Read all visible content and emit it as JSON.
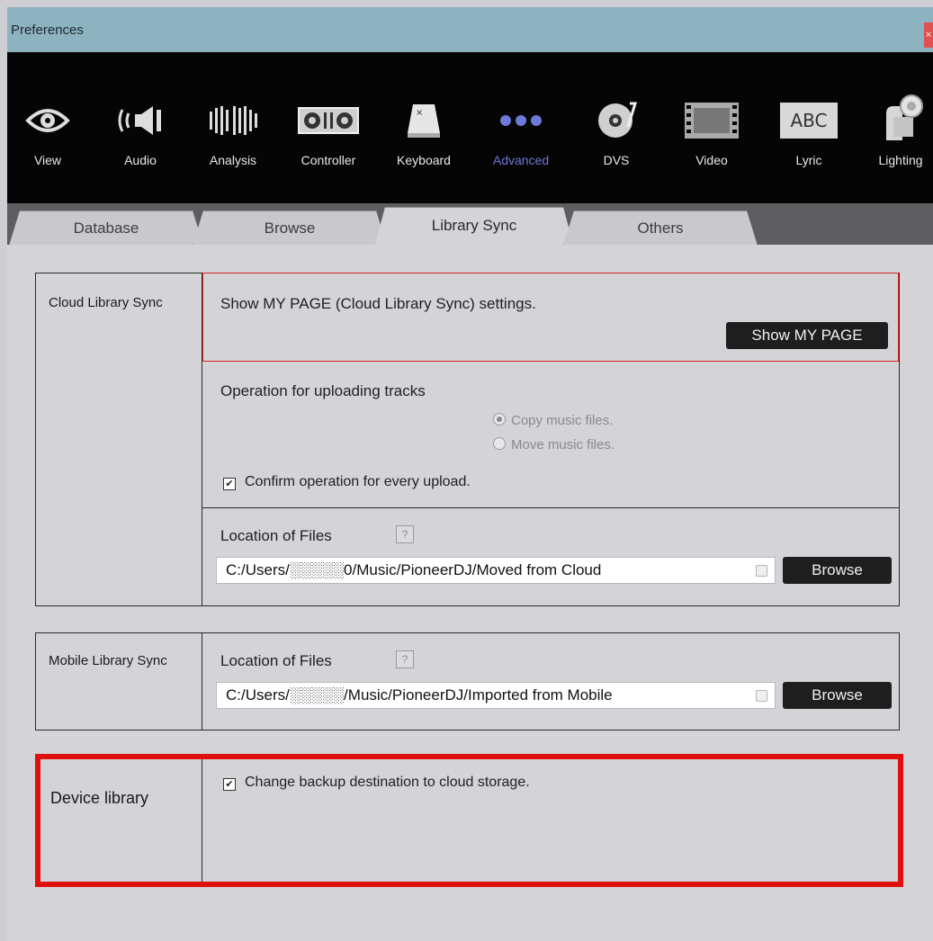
{
  "window": {
    "title": "Preferences",
    "close_label": "×"
  },
  "toolbar": [
    {
      "label": "View",
      "icon": "eye-icon"
    },
    {
      "label": "Audio",
      "icon": "speaker-icon"
    },
    {
      "label": "Analysis",
      "icon": "waveform-bars-icon"
    },
    {
      "label": "Controller",
      "icon": "controller-icon"
    },
    {
      "label": "Keyboard",
      "icon": "keyboard-key-icon"
    },
    {
      "label": "Advanced",
      "icon": "three-dots-icon",
      "active": true
    },
    {
      "label": "DVS",
      "icon": "turntable-icon"
    },
    {
      "label": "Video",
      "icon": "film-strip-icon"
    },
    {
      "label": "Lyric",
      "icon": "abc-icon",
      "icon_text": "ABC"
    },
    {
      "label": "Lighting",
      "icon": "moving-head-light-icon"
    }
  ],
  "tabs": [
    {
      "label": "Database"
    },
    {
      "label": "Browse"
    },
    {
      "label": "Library Sync",
      "active": true
    },
    {
      "label": "Others"
    }
  ],
  "cloud": {
    "category": "Cloud Library Sync",
    "show_text": "Show MY PAGE (Cloud Library Sync) settings.",
    "show_button": "Show MY PAGE",
    "upload_heading": "Operation for uploading tracks",
    "radio_copy": "Copy music files.",
    "radio_move": "Move music files.",
    "confirm_label": "Confirm operation for every upload.",
    "location_label": "Location of Files",
    "help": "?",
    "path": "C:/Users/░░░░░0/Music/PioneerDJ/Moved from Cloud",
    "browse": "Browse"
  },
  "mobile": {
    "category": "Mobile Library Sync",
    "location_label": "Location of Files",
    "help": "?",
    "path": "C:/Users/░░░░░/Music/PioneerDJ/Imported from Mobile",
    "browse": "Browse"
  },
  "device": {
    "category": "Device library",
    "checkbox_label": "Change backup destination to cloud storage."
  },
  "colors": {
    "accent_active": "#6f79d8",
    "highlight": "#e01010",
    "toolbar_bg": "#050505"
  }
}
